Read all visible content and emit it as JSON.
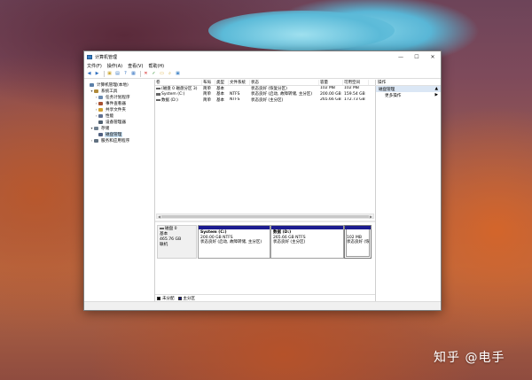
{
  "window": {
    "title": "计算机管理",
    "controls": {
      "minimize": "—",
      "maximize": "☐",
      "close": "✕"
    }
  },
  "menu": [
    "文件(F)",
    "操作(A)",
    "查看(V)",
    "帮助(H)"
  ],
  "toolbar": {
    "buttons": [
      {
        "icon": "back-arrow-icon",
        "glyph": "◀",
        "color": "#2f6fbf"
      },
      {
        "icon": "forward-arrow-icon",
        "glyph": "▶",
        "color": "#2f6fbf"
      },
      {
        "icon": "up-folder-icon",
        "glyph": "▣",
        "color": "#c9a227"
      },
      {
        "icon": "properties-icon",
        "glyph": "▤",
        "color": "#2f6fbf"
      },
      {
        "icon": "help-icon",
        "glyph": "?",
        "color": "#2f6fbf"
      },
      {
        "icon": "view-icon",
        "glyph": "▦",
        "color": "#2f6fbf"
      },
      {
        "icon": "delete-icon",
        "glyph": "✕",
        "color": "#d01010"
      },
      {
        "icon": "check-icon",
        "glyph": "✓",
        "color": "#2d8b2d"
      },
      {
        "icon": "folder-open-icon",
        "glyph": "▭",
        "color": "#d8a220"
      },
      {
        "icon": "search-icon",
        "glyph": "⌕",
        "color": "#c9a227"
      },
      {
        "icon": "export-icon",
        "glyph": "▣",
        "color": "#3a7fc4"
      }
    ]
  },
  "tree": [
    {
      "label": "计算机管理(本地)",
      "expander": "",
      "color": "#5b7fa8",
      "indent": 0
    },
    {
      "label": "系统工具",
      "expander": "▾",
      "color": "#b08a3a",
      "indent": 1
    },
    {
      "label": "任务计划程序",
      "expander": "›",
      "color": "#6a8ab0",
      "indent": 2
    },
    {
      "label": "事件查看器",
      "expander": "›",
      "color": "#a85030",
      "indent": 2
    },
    {
      "label": "共享文件夹",
      "expander": "›",
      "color": "#d0a030",
      "indent": 2
    },
    {
      "label": "性能",
      "expander": "›",
      "color": "#607090",
      "indent": 2
    },
    {
      "label": "设备管理器",
      "expander": "",
      "color": "#506070",
      "indent": 2
    },
    {
      "label": "存储",
      "expander": "▾",
      "color": "#708090",
      "indent": 1
    },
    {
      "label": "磁盘管理",
      "expander": "",
      "color": "#506080",
      "indent": 2,
      "selected": true
    },
    {
      "label": "服务和应用程序",
      "expander": "›",
      "color": "#607080",
      "indent": 1
    }
  ],
  "volumes": {
    "headers": [
      "卷",
      "布局",
      "类型",
      "文件系统",
      "状态",
      "容量",
      "可用空间"
    ],
    "rows": [
      [
        "(磁盘 0 磁盘分区 3)",
        "简单",
        "基本",
        "",
        "状态良好 (恢复分区)",
        "102 MB",
        "102 MB"
      ],
      [
        "System (C:)",
        "简单",
        "基本",
        "NTFS",
        "状态良好 (启动, 故障转储, 主分区)",
        "200.00 GB",
        "159.54 GB"
      ],
      [
        "数据 (D:)",
        "简单",
        "基本",
        "NTFS",
        "状态良好 (主分区)",
        "265.66 GB",
        "172.73 GB"
      ]
    ]
  },
  "disk": {
    "name": "磁盘 0",
    "type": "基本",
    "size": "465.76 GB",
    "status": "联机",
    "partitions": [
      {
        "name": "System  (C:)",
        "size": "200.00 GB NTFS",
        "status": "状态良好 (启动, 故障转储, 主分区)"
      },
      {
        "name": "数据  (D:)",
        "size": "265.66 GB NTFS",
        "status": "状态良好 (主分区)"
      },
      {
        "name": "",
        "size": "102 MB",
        "status": "状态良好 (恢"
      }
    ]
  },
  "legend": [
    {
      "label": "未分配",
      "color": "#000000"
    },
    {
      "label": "主分区",
      "color": "#1b1b8f"
    }
  ],
  "actions": {
    "header": "操作",
    "section": "磁盘管理",
    "section_arrow": "▲",
    "more": "更多操作",
    "more_arrow": "▶"
  },
  "watermark": "知乎 @电手"
}
